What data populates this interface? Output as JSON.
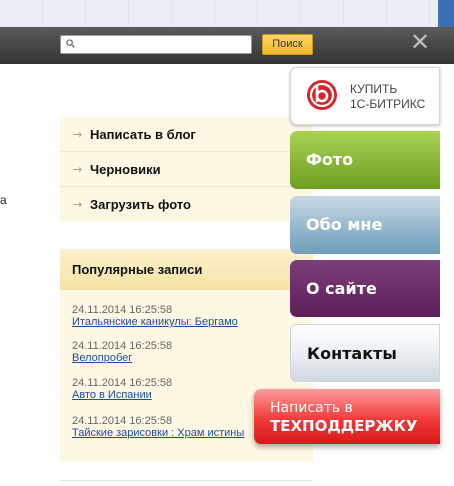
{
  "search": {
    "placeholder": "",
    "button_label": "Поиск"
  },
  "toolbar": {
    "close_symbol": "✕"
  },
  "left_fragment": "а",
  "blog_menu": {
    "arrow": "→",
    "items": [
      {
        "label": "Написать в блог"
      },
      {
        "label": "Черновики"
      },
      {
        "label": "Загрузить фото"
      }
    ]
  },
  "popular": {
    "title": "Популярные записи",
    "posts": [
      {
        "date": "24.11.2014 16:25:58",
        "title": "Итальянские каникулы: Бергамо"
      },
      {
        "date": "24.11.2014 16:25:58",
        "title": "Велопробег"
      },
      {
        "date": "24.11.2014 16:25:58",
        "title": "Авто в Испании"
      },
      {
        "date": "24.11.2014 16:25:58",
        "title": "Тайские зарисовки : Храм истины"
      }
    ]
  },
  "side_panel": {
    "buy": {
      "line1": "КУПИТЬ",
      "line2": "1С-БИТРИКС",
      "logo_icon": "bitrix-logo-icon"
    },
    "buttons": [
      {
        "label": "Фото",
        "color": "#8cbc35"
      },
      {
        "label": "Обо мне",
        "color": "#8fb5cc"
      },
      {
        "label": "О сайте",
        "color": "#6a2b68"
      },
      {
        "label": "Контакты",
        "color": "#e7ecf0"
      }
    ],
    "support": {
      "line1": "Написать в",
      "line2": "ТЕХПОДДЕРЖКУ",
      "color": "#ee3333"
    }
  }
}
